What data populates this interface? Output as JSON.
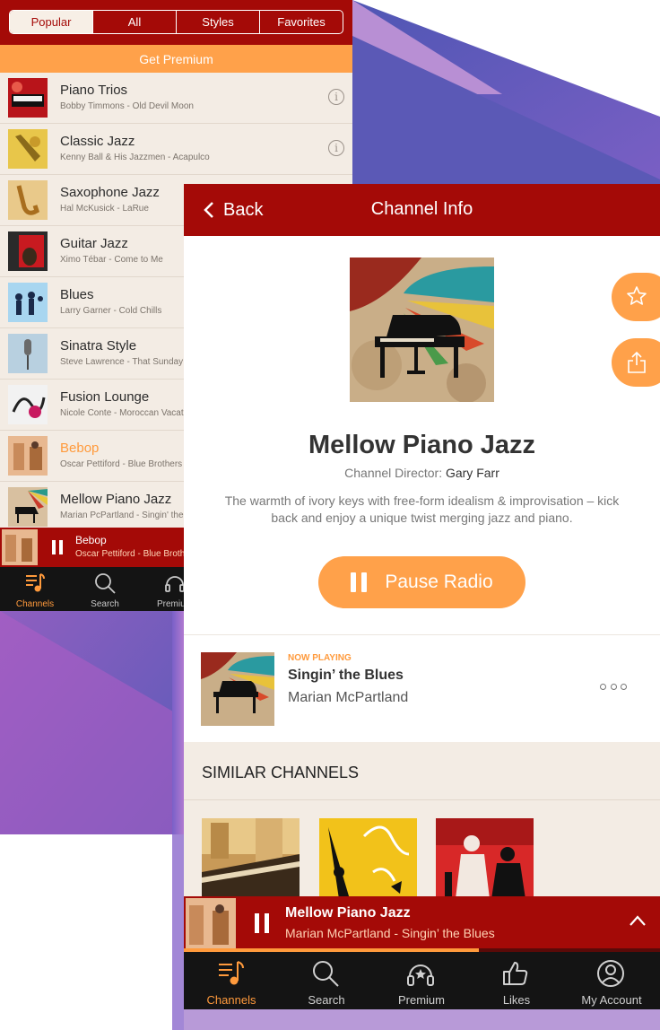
{
  "colors": {
    "brand_red": "#a40a07",
    "accent_orange": "#ffa14a",
    "cream": "#f3ece4",
    "tabbar": "#141414"
  },
  "list_screen": {
    "segments": [
      {
        "label": "Popular",
        "active": true
      },
      {
        "label": "All",
        "active": false
      },
      {
        "label": "Styles",
        "active": false
      },
      {
        "label": "Favorites",
        "active": false
      }
    ],
    "premium_label": "Get Premium",
    "channels": [
      {
        "title": "Piano Trios",
        "subtitle": "Bobby Timmons - Old Devil Moon",
        "info_icon": true
      },
      {
        "title": "Classic Jazz",
        "subtitle": "Kenny Ball & His Jazzmen - Acapulco",
        "info_icon": true
      },
      {
        "title": "Saxophone Jazz",
        "subtitle": "Hal McKusick - LaRue"
      },
      {
        "title": "Guitar Jazz",
        "subtitle": "Ximo Tébar - Come to Me"
      },
      {
        "title": "Blues",
        "subtitle": "Larry Garner - Cold Chills"
      },
      {
        "title": "Sinatra Style",
        "subtitle": "Steve Lawrence - That Sunday"
      },
      {
        "title": "Fusion Lounge",
        "subtitle": "Nicole Conte - Moroccan Vacation"
      },
      {
        "title": "Bebop",
        "subtitle": "Oscar Pettiford - Blue Brothers",
        "highlighted": true
      },
      {
        "title": "Mellow Piano Jazz",
        "subtitle": "Marian PcPartland - Singin' the Blues"
      }
    ],
    "mini_player": {
      "title": "Bebop",
      "subtitle": "Oscar Pettiford - Blue Brothers"
    },
    "tabs": [
      {
        "label": "Channels",
        "icon": "channels-icon",
        "active": true
      },
      {
        "label": "Search",
        "icon": "search-icon"
      },
      {
        "label": "Premium",
        "icon": "premium-icon"
      }
    ]
  },
  "info_screen": {
    "back_label": "Back",
    "title": "Channel Info",
    "channel_name": "Mellow Piano Jazz",
    "director_label": "Channel Director:",
    "director_name": "Gary Farr",
    "description": "The warmth of ivory keys with free-form idealism & improvisation – kick back and enjoy a unique twist merging jazz and piano.",
    "pause_label": "Pause Radio",
    "now_playing": {
      "label": "NOW PLAYING",
      "title": "Singin’ the Blues",
      "artist": "Marian McPartland"
    },
    "similar_title": "SIMILAR CHANNELS",
    "player": {
      "title": "Mellow Piano Jazz",
      "subtitle": "Marian McPartland - Singin’ the Blues",
      "progress": 0.62
    },
    "tabs": [
      {
        "label": "Channels",
        "icon": "channels-icon",
        "active": true
      },
      {
        "label": "Search",
        "icon": "search-icon"
      },
      {
        "label": "Premium",
        "icon": "premium-icon"
      },
      {
        "label": "Likes",
        "icon": "thumbs-up-icon"
      },
      {
        "label": "My Account",
        "icon": "account-icon"
      }
    ]
  }
}
